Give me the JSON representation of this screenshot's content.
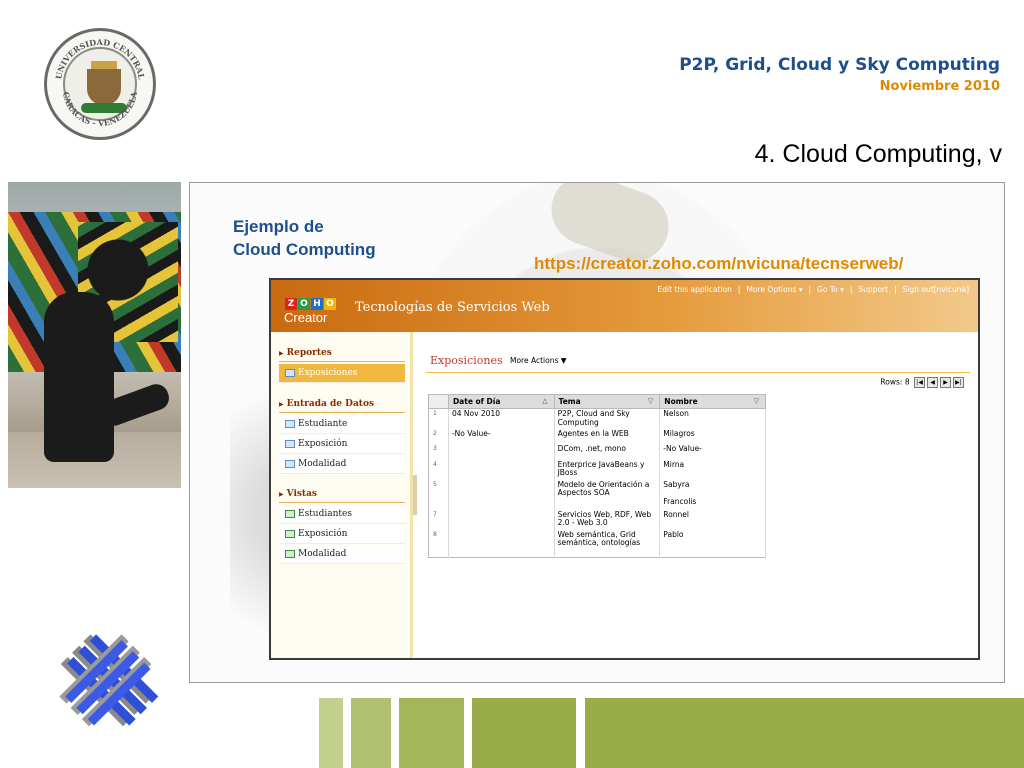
{
  "header": {
    "title": "P2P, Grid, Cloud y Sky Computing",
    "date": "Noviembre 2010",
    "slide_title": "4. Cloud Computing, v"
  },
  "seal": {
    "text_top": "UNIVERSIDAD CENTRAL",
    "text_bottom": "CARACAS - VENEZUELA"
  },
  "main": {
    "example_line1": "Ejemplo de",
    "example_line2": "Cloud Computing",
    "url": "https://creator.zoho.com/nvicuna/tecnserweb/"
  },
  "zoho": {
    "logo_letters": [
      "Z",
      "O",
      "H",
      "O"
    ],
    "logo_sub": "Creator",
    "app_name": "Tecnologías de Servicios Web",
    "nav": [
      "Edit this application",
      "|",
      "More Options ▾",
      "|",
      "Go To ▾",
      "|",
      "Support",
      "|",
      "Sign out[nvicuna]"
    ],
    "sidebar": {
      "sec1": "Reportes",
      "sec1_items": [
        "Exposiciones"
      ],
      "sec2": "Entrada de Datos",
      "sec2_items": [
        "Estudiante",
        "Exposición",
        "Modalidad"
      ],
      "sec3": "Vistas",
      "sec3_items": [
        "Estudiantes",
        "Exposición",
        "Modalidad"
      ]
    },
    "content": {
      "heading": "Exposiciones",
      "more_actions": "More Actions ▼",
      "rows_label": "Rows: 8",
      "columns": [
        "Date of Día",
        "Tema",
        "Nombre"
      ],
      "rows": [
        {
          "n": "1",
          "date": "04 Nov 2010",
          "tema": "P2P, Cloud and Sky Computing",
          "nombre": "Nelson"
        },
        {
          "n": "2",
          "date": "-No Value-",
          "tema": "Agentes en la WEB",
          "nombre": "Milagros"
        },
        {
          "n": "3",
          "date": "",
          "tema": "DCom, .net, mono",
          "nombre": "-No Value-"
        },
        {
          "n": "4",
          "date": "",
          "tema": "Enterprice JavaBeans y JBoss",
          "nombre": "Mirna"
        },
        {
          "n": "5",
          "date": "",
          "tema": "Modelo de Orientación a Aspectos SOA",
          "nombre": "Sabyra\n\nFrancolis"
        },
        {
          "n": "7",
          "date": "",
          "tema": "Servicios Web, RDF, Web 2.0 - Web 3.0",
          "nombre": "Ronnel"
        },
        {
          "n": "8",
          "date": "",
          "tema": "Web semántica, Grid semántica, ontologías",
          "nombre": "Pablo"
        }
      ]
    }
  },
  "colors": {
    "title_blue": "#1d4f8c",
    "accent_orange": "#e08a00",
    "band_green": "#9aac4a"
  }
}
